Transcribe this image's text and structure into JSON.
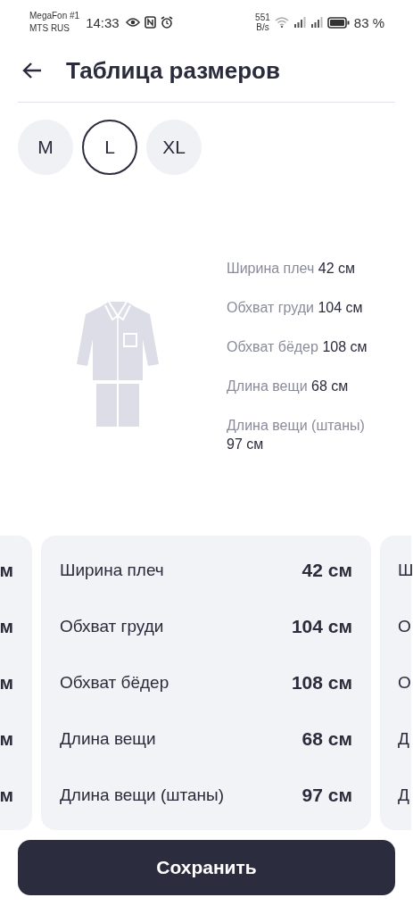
{
  "status_bar": {
    "carrier_1": "MegaFon #1",
    "carrier_2": "MTS RUS",
    "time": "14:33",
    "speed_value": "551",
    "speed_unit": "B/s",
    "battery": "83 %"
  },
  "header": {
    "title": "Таблица размеров"
  },
  "sizes": [
    {
      "label": "M",
      "selected": false
    },
    {
      "label": "L",
      "selected": true
    },
    {
      "label": "XL",
      "selected": false
    }
  ],
  "measurements": [
    {
      "label": "Ширина плеч",
      "value": "42 см"
    },
    {
      "label": "Обхват груди",
      "value": "104 см"
    },
    {
      "label": "Обхват бёдер",
      "value": "108 см"
    },
    {
      "label": "Длина вещи",
      "value": "68 см"
    },
    {
      "label": "Длина вещи (штаны)",
      "value": "97 см"
    }
  ],
  "cards": [
    {
      "kind": "prev",
      "rows": [
        {
          "value": "м"
        },
        {
          "value": "м"
        },
        {
          "value": "м"
        },
        {
          "value": "м"
        },
        {
          "value": "м"
        }
      ]
    },
    {
      "kind": "current",
      "rows": [
        {
          "label": "Ширина плеч",
          "value": "42 см"
        },
        {
          "label": "Обхват груди",
          "value": "104 см"
        },
        {
          "label": "Обхват бёдер",
          "value": "108 см"
        },
        {
          "label": "Длина вещи",
          "value": "68 см"
        },
        {
          "label": "Длина вещи (штаны)",
          "value": "97 см"
        }
      ]
    },
    {
      "kind": "next",
      "rows": [
        {
          "label": "Ш"
        },
        {
          "label": "О"
        },
        {
          "label": "О"
        },
        {
          "label": "Д"
        },
        {
          "label": "Д"
        }
      ]
    }
  ],
  "save_button": "Сохранить"
}
